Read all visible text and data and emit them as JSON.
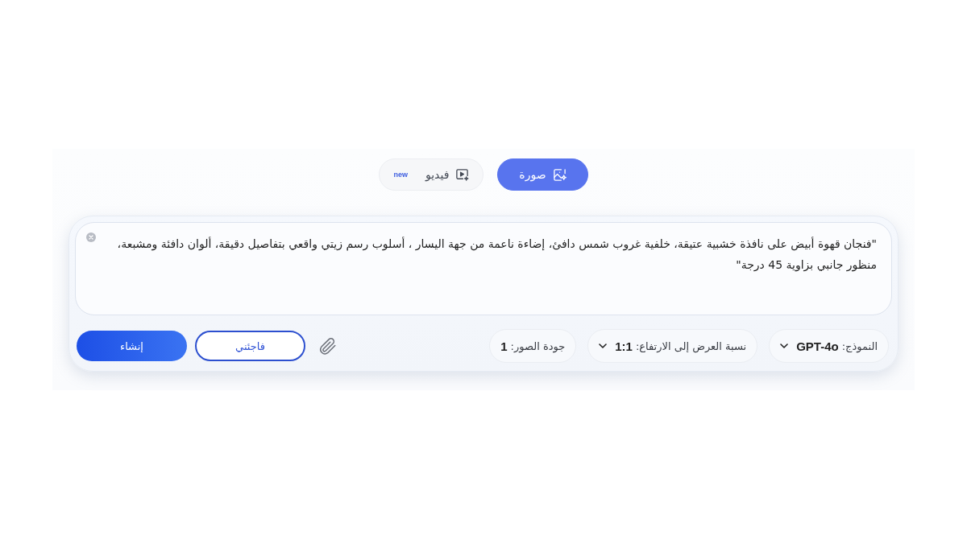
{
  "mode_tabs": [
    {
      "label": "صورة",
      "selected": true
    },
    {
      "label": "فيديو",
      "selected": false,
      "badge": "new"
    }
  ],
  "prompt": {
    "value": "\"فنجان قهوة أبيض على نافذة خشبية عتيقة، خلفية غروب شمس دافئ، إضاءة ناعمة من جهة اليسار ، أسلوب رسم زيتي واقعي بتفاصيل دقيقة، ألوان دافئة ومشبعة، منظور جانبي بزاوية 45 درجة\""
  },
  "options": [
    {
      "label": "النموذج:",
      "value": "GPT-4o",
      "kind": "dropdown"
    },
    {
      "label": "نسبة العرض إلى الارتفاع:",
      "value": "1:1",
      "kind": "dropdown"
    },
    {
      "label": "جودة الصور:",
      "value": "1",
      "kind": "plain"
    }
  ],
  "actions": {
    "surprise": "فاجئني",
    "generate": "إنشاء"
  }
}
